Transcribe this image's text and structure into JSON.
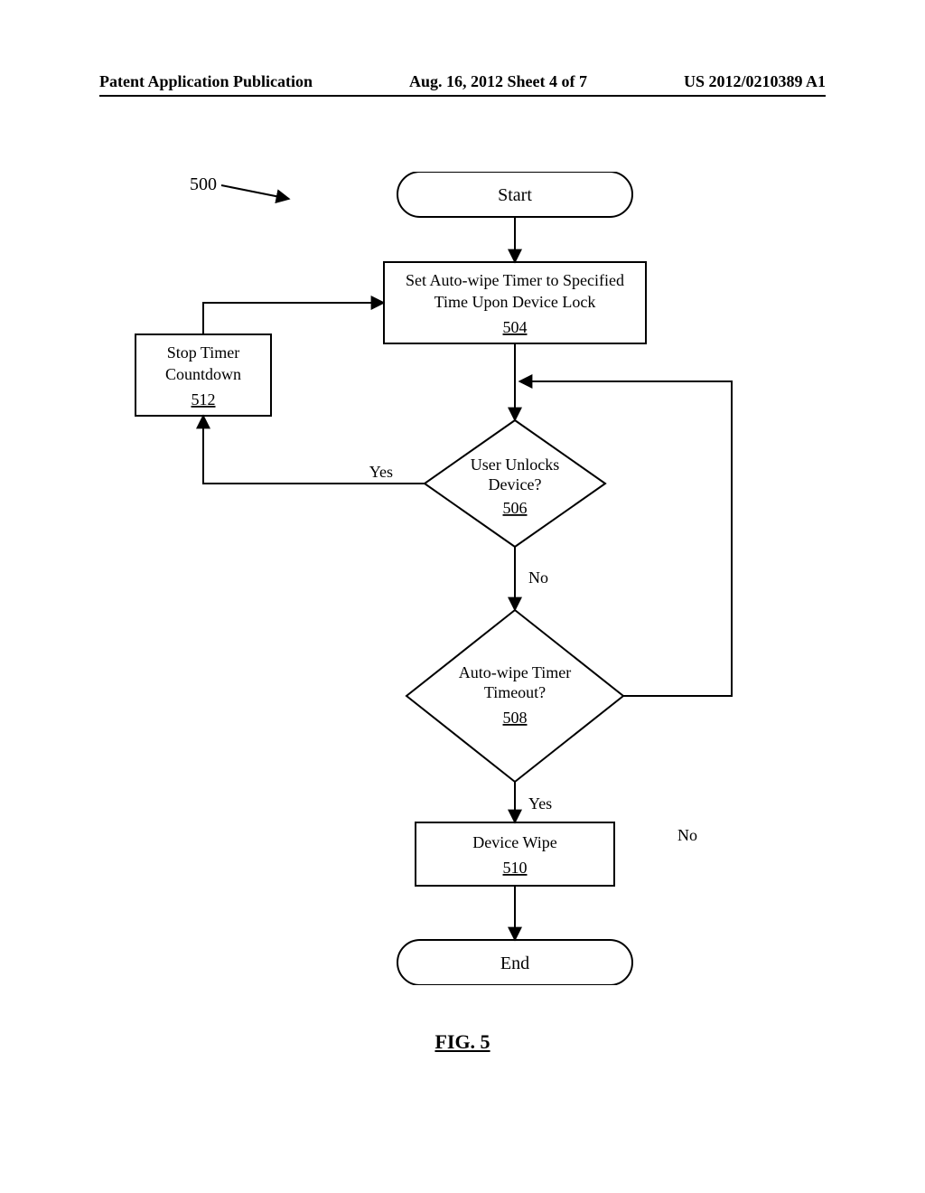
{
  "header": {
    "left": "Patent Application Publication",
    "center": "Aug. 16, 2012  Sheet 4 of 7",
    "right": "US 2012/0210389 A1"
  },
  "figure_ref": "500",
  "nodes": {
    "start": "Start",
    "set_timer": {
      "line1": "Set Auto-wipe Timer to Specified",
      "line2": "Time Upon Device Lock",
      "num": "504"
    },
    "stop_timer": {
      "line1": "Stop Timer",
      "line2": "Countdown",
      "num": "512"
    },
    "unlocks": {
      "line1": "User Unlocks",
      "line2": "Device?",
      "num": "506"
    },
    "timeout": {
      "line1": "Auto-wipe Timer",
      "line2": "Timeout?",
      "num": "508"
    },
    "wipe": {
      "line1": "Device Wipe",
      "num": "510"
    },
    "end": "End"
  },
  "edges": {
    "yes": "Yes",
    "no": "No"
  },
  "fig_label": "FIG. 5"
}
